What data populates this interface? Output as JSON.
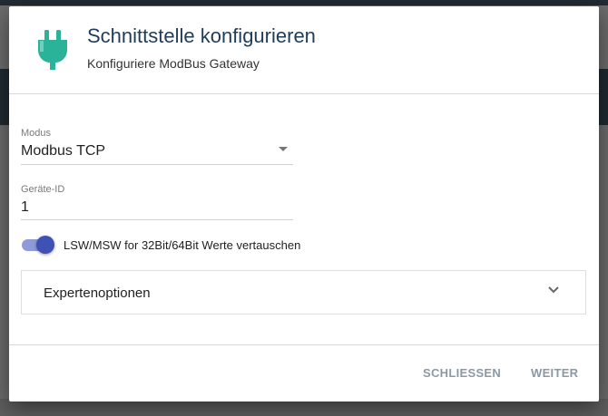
{
  "dialog": {
    "title": "Schnittstelle konfigurieren",
    "subtitle": "Konfiguriere ModBus Gateway",
    "icon": "plug-icon",
    "accent_color": "#2bb39a"
  },
  "form": {
    "modus": {
      "label": "Modus",
      "value": "Modbus TCP"
    },
    "device_id": {
      "label": "Geräte-ID",
      "value": "1"
    },
    "swap_toggle": {
      "label": "LSW/MSW for 32Bit/64Bit Werte vertauschen",
      "checked": true,
      "color": "#3f51b5"
    },
    "expert": {
      "label": "Expertenoptionen",
      "expanded": false
    }
  },
  "footer": {
    "close_label": "SCHLIESSEN",
    "next_label": "WEITER"
  }
}
